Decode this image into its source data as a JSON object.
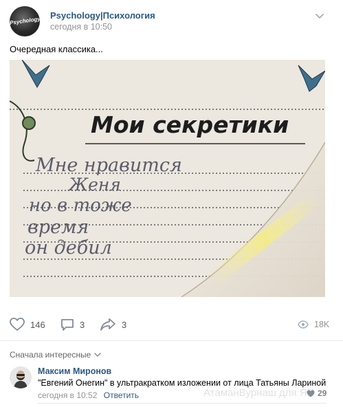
{
  "post": {
    "group_name": "Psychology|Психология",
    "avatar_text": "Psychology",
    "time": "сегодня в 10:50",
    "text": "Очередная классика...",
    "photo": {
      "heading": "Мои секретики",
      "handwriting": [
        "Мне нравится",
        "Женя",
        "но в тоже",
        "время",
        "он дебил"
      ]
    }
  },
  "actions": {
    "likes": "146",
    "comments": "3",
    "shares": "3",
    "views": "18K"
  },
  "comments_section": {
    "sort_label": "Сначала интересные",
    "comment": {
      "author": "Максим Миронов",
      "text": "\"Евгений Онегин\" в ультракратком изложении от лица Татьяны Лариной",
      "time": "сегодня в 10:52",
      "reply_label": "Ответить",
      "likes": "29"
    }
  },
  "watermark": "АтаманВурнаш для ЯП",
  "colors": {
    "link": "#2a5885",
    "muted": "#939393",
    "divider": "#e7e8ec"
  }
}
